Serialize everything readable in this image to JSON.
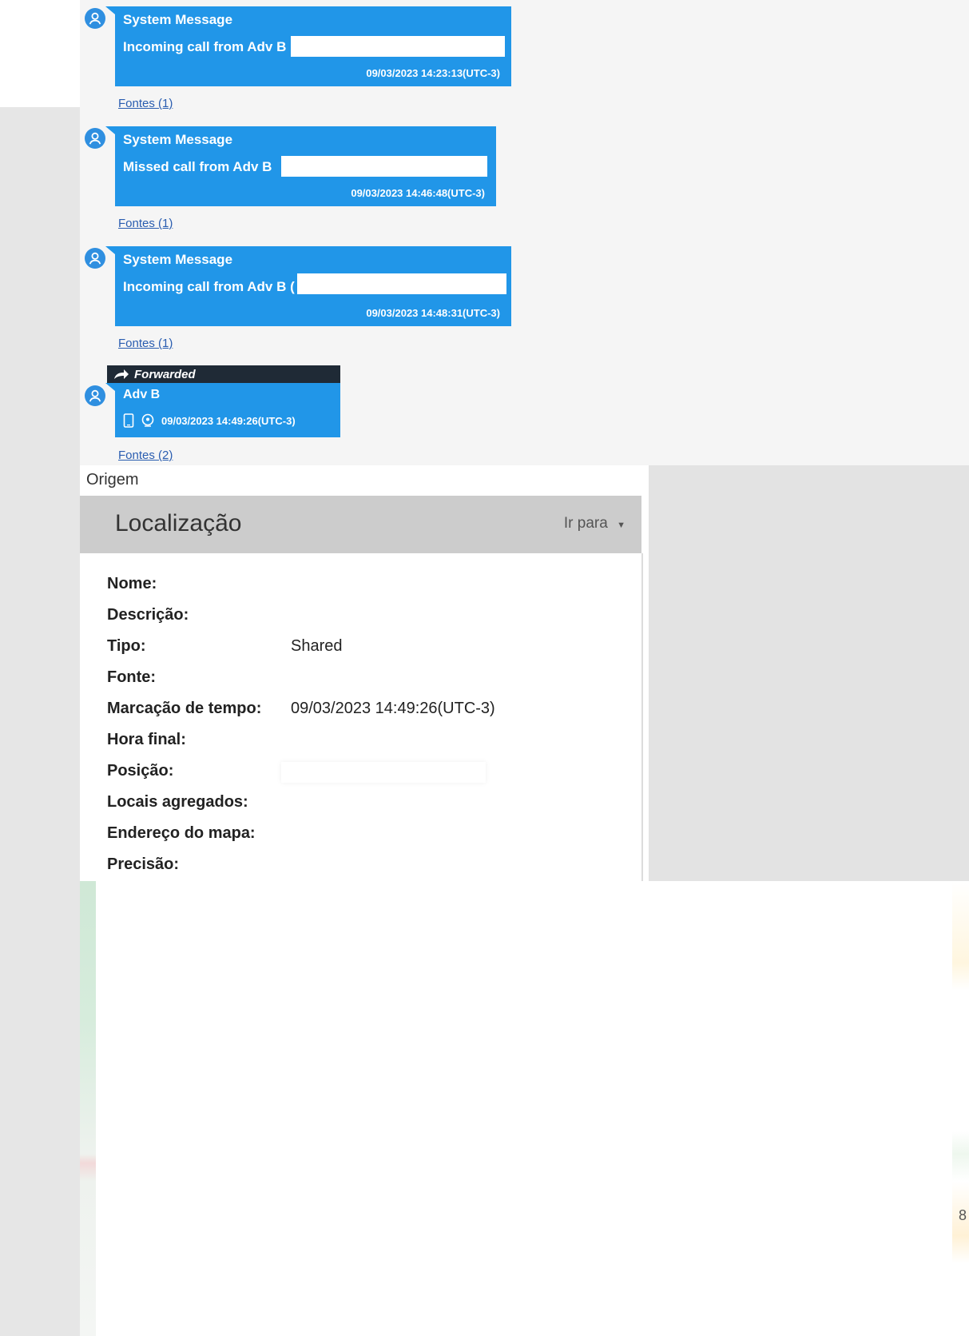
{
  "messages": [
    {
      "sender": "System Message",
      "body": "Incoming call from Adv B",
      "timestamp": "09/03/2023 14:23:13(UTC-3)",
      "sources": "Fontes (1)"
    },
    {
      "sender": "System Message",
      "body": "Missed call from Adv B",
      "timestamp": "09/03/2023 14:46:48(UTC-3)",
      "sources": "Fontes (1)"
    },
    {
      "sender": "System Message",
      "body": "Incoming call from Adv B (",
      "timestamp": "09/03/2023 14:48:31(UTC-3)",
      "sources": "Fontes (1)"
    }
  ],
  "forwarded": {
    "banner": "Forwarded",
    "sender": "Adv B",
    "timestamp": "09/03/2023 14:49:26(UTC-3)",
    "sources": "Fontes (2)",
    "icons": [
      "phone-icon",
      "location-pin-icon"
    ]
  },
  "location": {
    "origem": "Origem",
    "title": "Localização",
    "goto": "Ir para",
    "fields": [
      {
        "label": "Nome:",
        "value": ""
      },
      {
        "label": "Descrição:",
        "value": ""
      },
      {
        "label": "Tipo:",
        "value": "Shared"
      },
      {
        "label": "Fonte:",
        "value": ""
      },
      {
        "label": "Marcação de tempo:",
        "value": "09/03/2023 14:49:26(UTC-3)"
      },
      {
        "label": "Hora final:",
        "value": ""
      },
      {
        "label": "Posição:",
        "value": ""
      },
      {
        "label": "Locais agregados:",
        "value": ""
      },
      {
        "label": "Endereço do mapa:",
        "value": ""
      },
      {
        "label": "Precisão:",
        "value": ""
      }
    ]
  },
  "map_edge_text": "8",
  "colors": {
    "bubble": "#2196e8",
    "avatar": "#2f8fe0",
    "forwarded_banner": "#1f2a36",
    "link": "#2a5db0",
    "card_header": "#cccccc"
  }
}
